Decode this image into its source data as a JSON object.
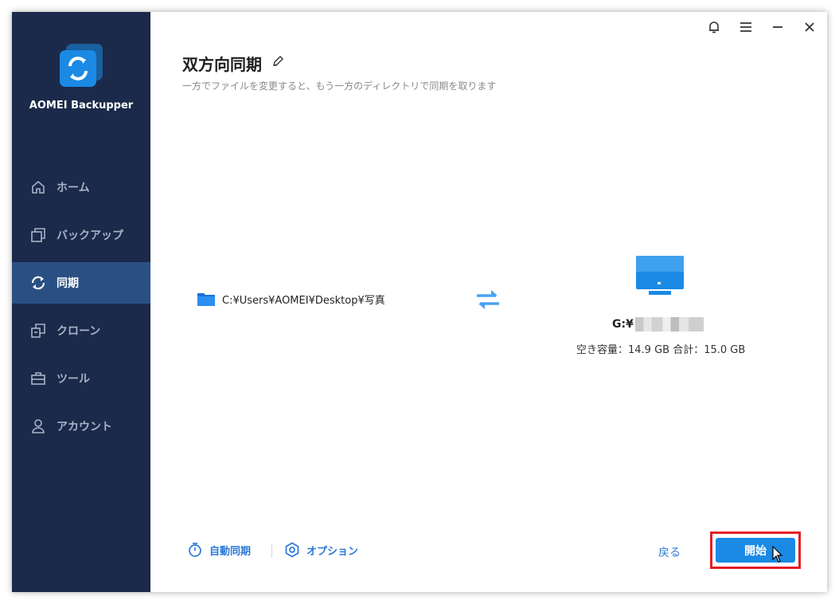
{
  "app": {
    "name": "AOMEI Backupper"
  },
  "sidebar": {
    "items": [
      {
        "label": "ホーム",
        "icon": "home-icon"
      },
      {
        "label": "バックアップ",
        "icon": "backup-icon"
      },
      {
        "label": "同期",
        "icon": "sync-icon",
        "active": true
      },
      {
        "label": "クローン",
        "icon": "clone-icon"
      },
      {
        "label": "ツール",
        "icon": "tools-icon"
      },
      {
        "label": "アカウント",
        "icon": "account-icon"
      }
    ]
  },
  "page": {
    "title": "双方向同期",
    "subtitle": "一方でファイルを変更すると、もう一方のディレクトリで同期を取ります"
  },
  "source": {
    "path": "C:¥Users¥AOMEI¥Desktop¥写真"
  },
  "destination": {
    "label": "G:¥",
    "space": "空き容量：14.9 GB 合計：15.0 GB"
  },
  "footer": {
    "auto_sync": "自動同期",
    "options": "オプション",
    "back": "戻る",
    "start": "開始"
  },
  "colors": {
    "sidebar_bg": "#1b2a4a",
    "active_item": "#2a5083",
    "accent": "#1a8ae5",
    "highlight": "#e41e26"
  }
}
